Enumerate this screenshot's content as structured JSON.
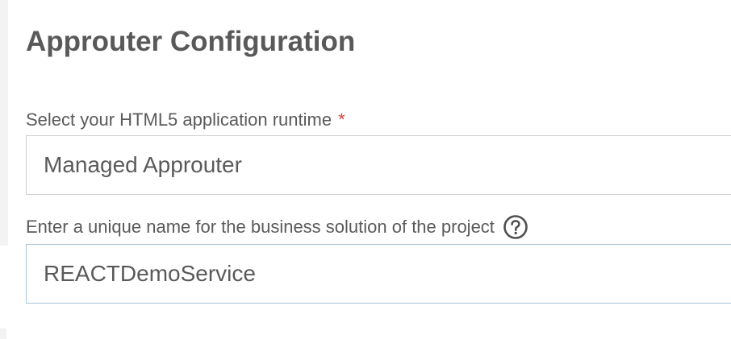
{
  "page": {
    "title": "Approuter Configuration"
  },
  "runtime_field": {
    "label": "Select your HTML5 application runtime",
    "required_marker": "*",
    "selected_value": "Managed Approuter"
  },
  "solution_name_field": {
    "label": "Enter a unique name for the business solution of the project",
    "help_icon": "question-circle-icon",
    "value": "REACTDemoService"
  },
  "colors": {
    "text": "#5a5a5a",
    "required": "#d64541",
    "border": "#d0d0d0",
    "focus_border": "#a9c6dd"
  }
}
